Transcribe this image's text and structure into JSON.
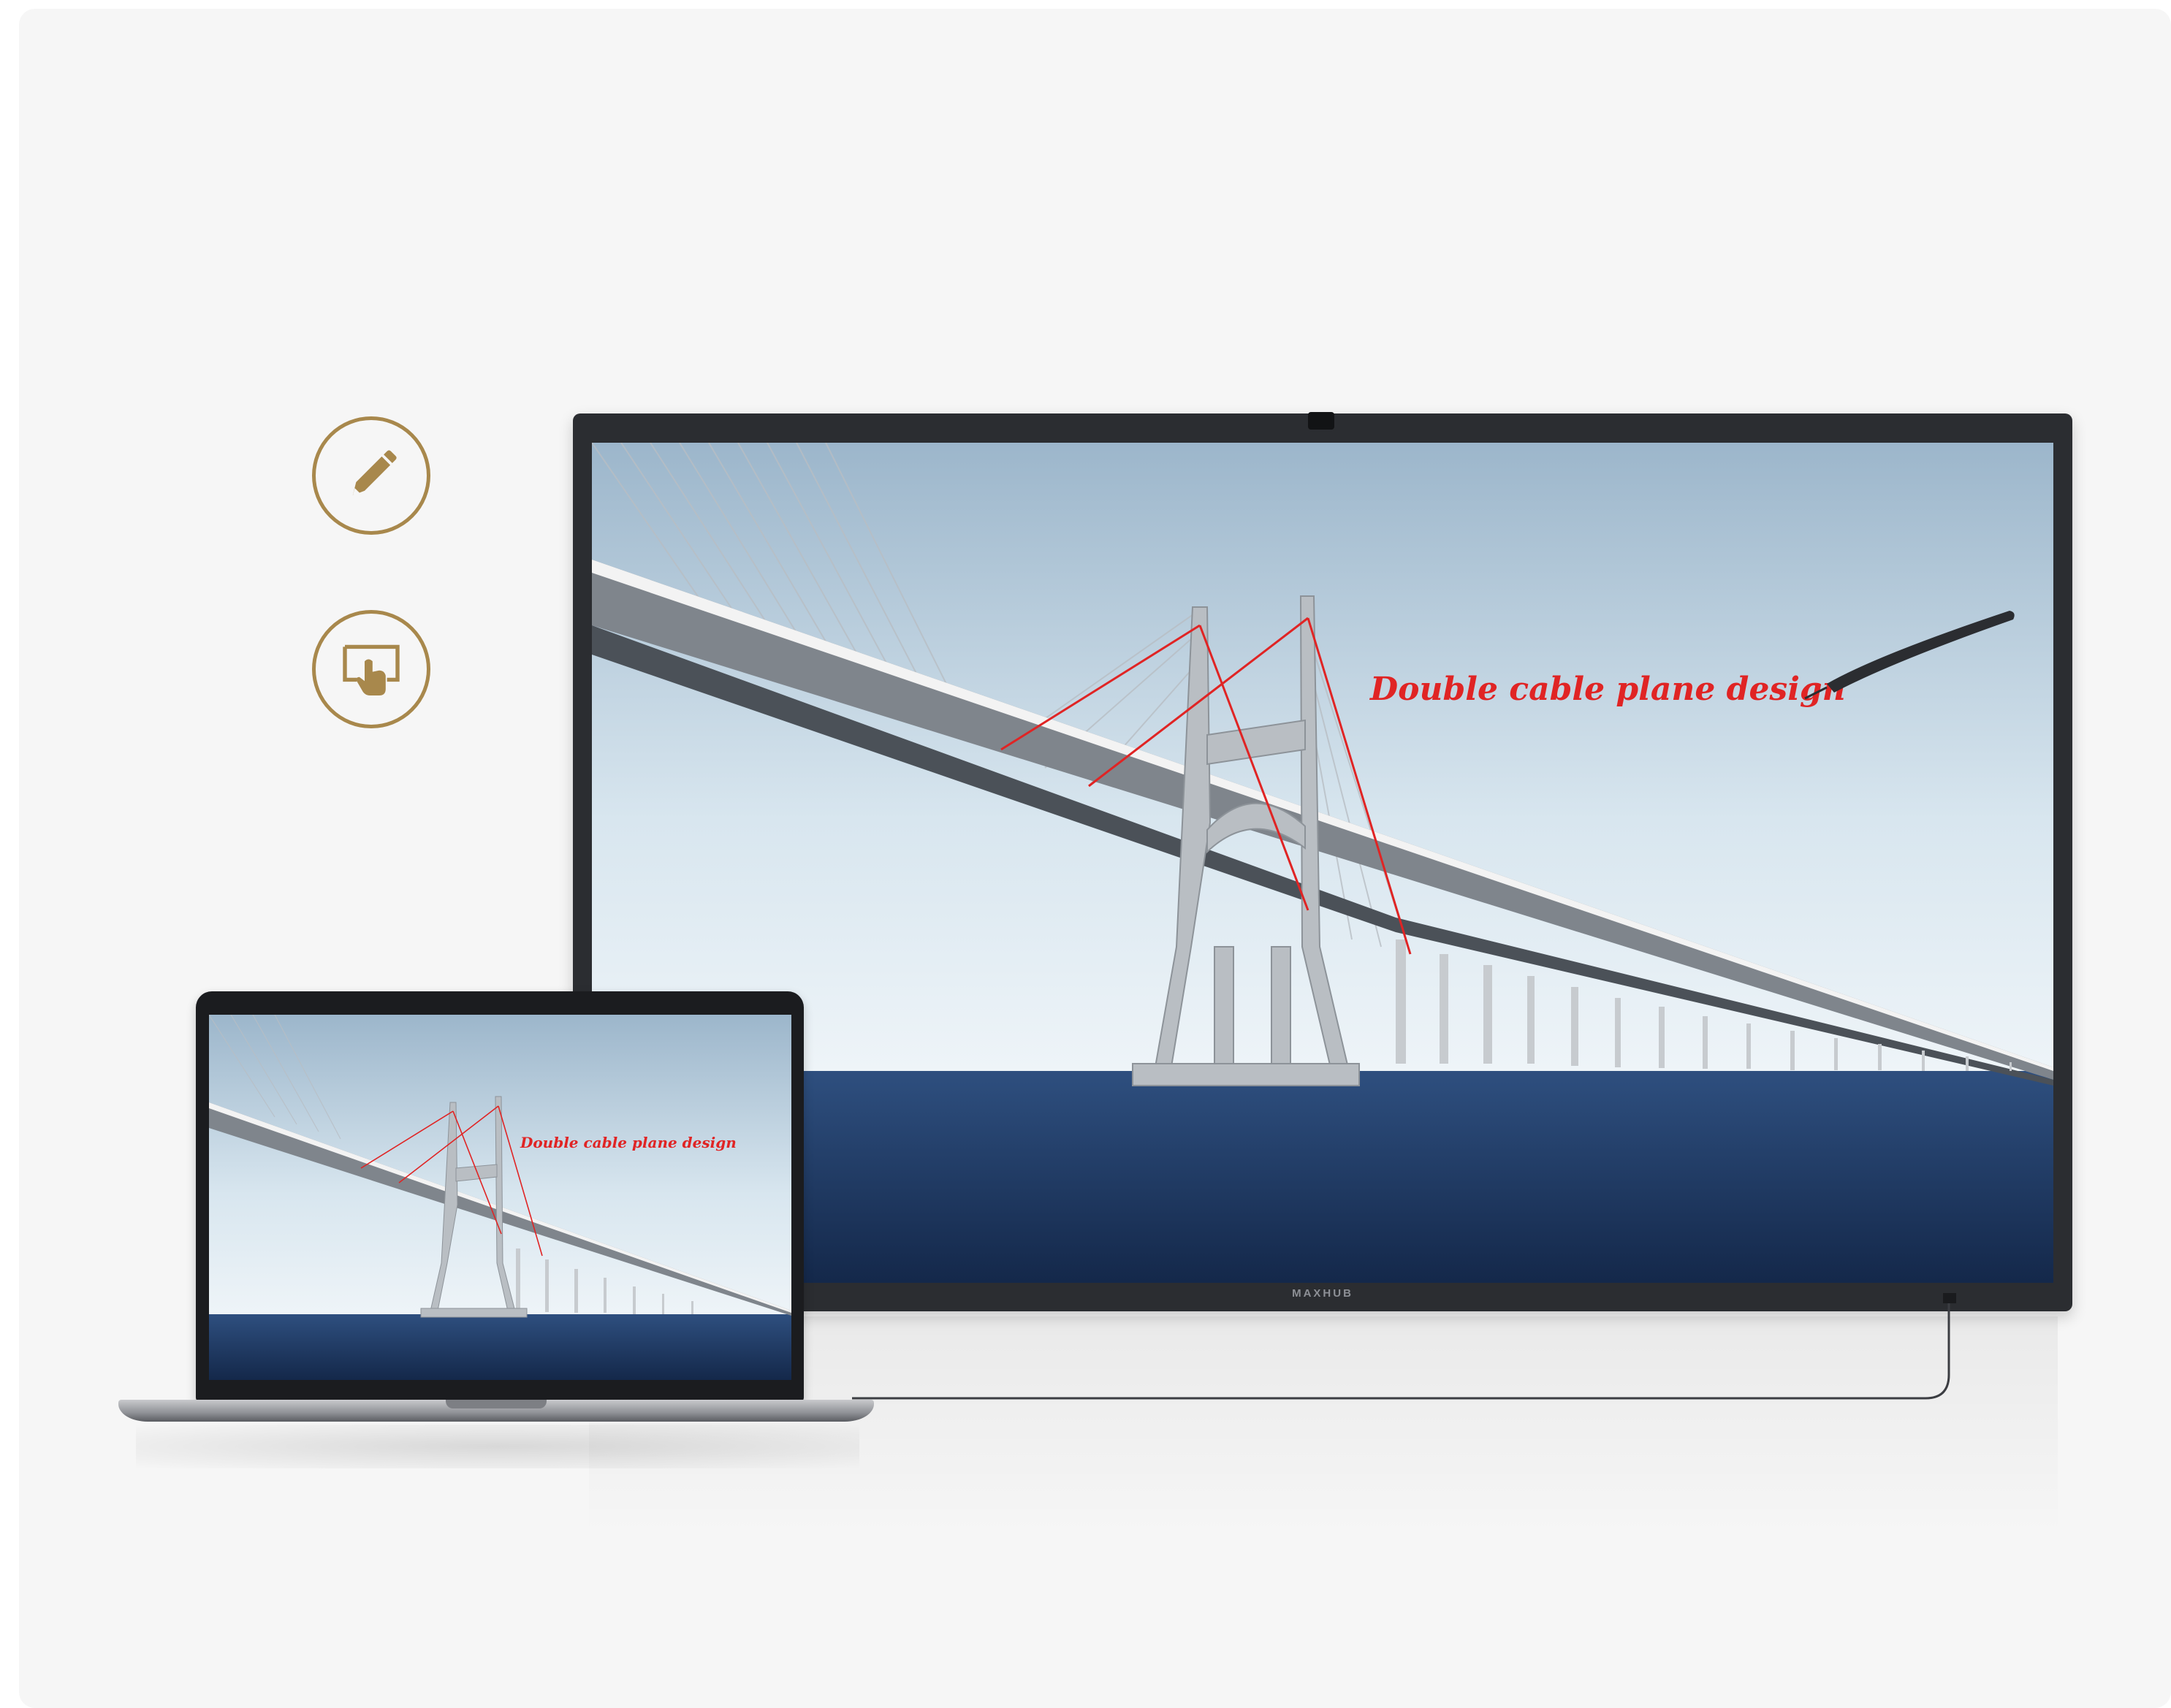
{
  "annotation_text": "Double cable plane design",
  "display_brand": "MAXHUB",
  "icons": {
    "pen": "pen-icon",
    "touch": "touch-screen-icon"
  },
  "colors": {
    "accent_gold": "#a8884c",
    "annotation_red": "#e02424"
  }
}
